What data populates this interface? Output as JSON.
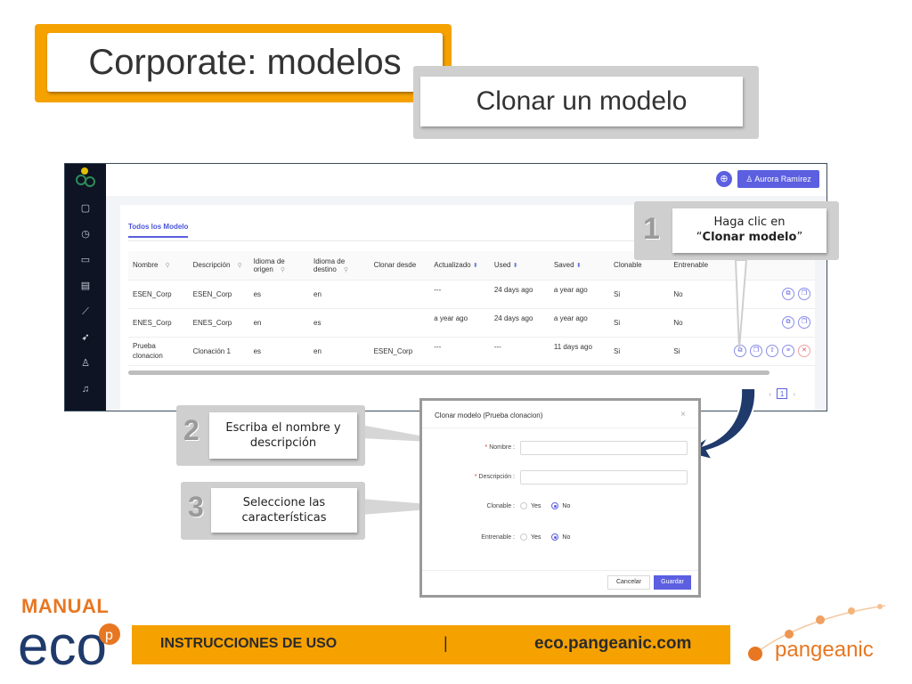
{
  "slide": {
    "title": "Corporate: modelos",
    "subtitle": "Clonar un modelo"
  },
  "app": {
    "user_label": "Aurora Ramírez",
    "tab_label": "Todos los Modelo",
    "columns": [
      "Nombre",
      "Descripción",
      "Idioma de origen",
      "Idioma de destino",
      "Clonar desde",
      "Actualizado",
      "Used",
      "Saved",
      "Clonable",
      "Entrenable"
    ],
    "rows": [
      {
        "nombre": "ESEN_Corp",
        "descripcion": "ESEN_Corp",
        "origen": "es",
        "destino": "en",
        "clonar": "",
        "actualizado": "---",
        "used": "24 days ago",
        "saved": "a year ago",
        "clonable": "Si",
        "entrenable": "No"
      },
      {
        "nombre": "ENES_Corp",
        "descripcion": "ENES_Corp",
        "origen": "en",
        "destino": "es",
        "clonar": "",
        "actualizado": "a year ago",
        "used": "24 days ago",
        "saved": "a year ago",
        "clonable": "Si",
        "entrenable": "No"
      },
      {
        "nombre": "Prueba clonacion",
        "descripcion": "Clonación 1",
        "origen": "es",
        "destino": "en",
        "clonar": "ESEN_Corp",
        "actualizado": "---",
        "used": "---",
        "saved": "11 days ago",
        "clonable": "Si",
        "entrenable": "Si"
      }
    ],
    "page_number": "1"
  },
  "callouts": {
    "one": {
      "num": "1",
      "line1": "Haga clic en",
      "quote_open": "“",
      "bold": "Clonar modelo",
      "quote_close": "”"
    },
    "two": {
      "num": "2",
      "text": "Escriba el nombre y descripción"
    },
    "three": {
      "num": "3",
      "text": "Seleccione las características"
    }
  },
  "modal": {
    "title": "Clonar modelo (Prueba clonacion)",
    "close": "×",
    "nombre_label": "Nombre :",
    "descripcion_label": "Descripción :",
    "clonable_label": "Clonable :",
    "entrenable_label": "Entrenable :",
    "yes": "Yes",
    "no": "No",
    "cancel": "Cancelar",
    "save": "Guardar"
  },
  "footer": {
    "manual": "MANUAL",
    "eco": "eco",
    "eco_p": "p",
    "left": "INSTRUCCIONES DE USO",
    "sep": "|",
    "url": "eco.pangeanic.com",
    "brand": "pangeanic"
  },
  "colors": {
    "accent_orange": "#f5a100",
    "brand_orange": "#e87722",
    "primary_purple": "#5b5fe0",
    "sidebar_dark": "#0e1424",
    "navy_arrow": "#1f3a6b"
  },
  "icons": [
    "globe-icon",
    "user-icon",
    "file-icon",
    "dashboard-icon",
    "monitor-icon",
    "list-icon",
    "chart-icon",
    "rocket-icon",
    "person-icon",
    "bell-icon",
    "search-icon",
    "sort-icon",
    "clone-icon",
    "copy-icon",
    "upload-icon",
    "menu-icon",
    "trash-icon"
  ]
}
